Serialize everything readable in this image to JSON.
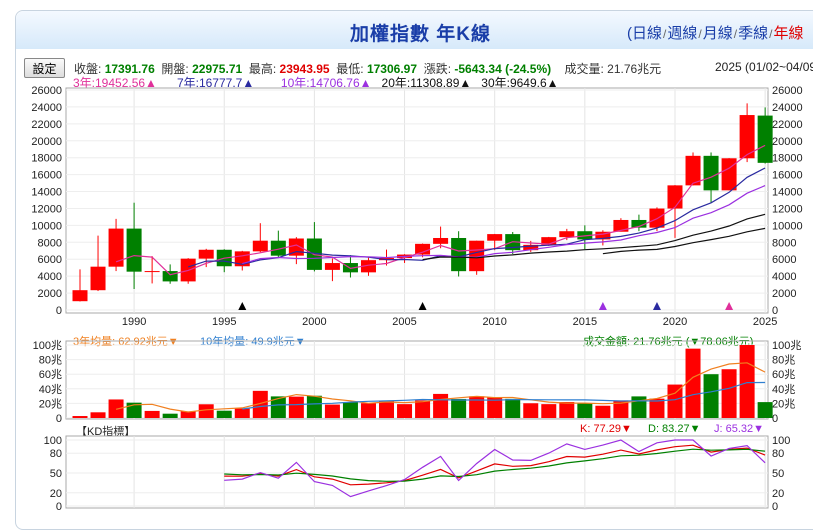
{
  "title": "加權指數 年K線",
  "periods": [
    {
      "label": "日線"
    },
    {
      "label": "週線"
    },
    {
      "label": "月線"
    },
    {
      "label": "季線"
    },
    {
      "label": "年線"
    }
  ],
  "settings_label": "設定",
  "quote": {
    "close_label": "收盤:",
    "close": "17391.76",
    "open_label": "開盤:",
    "open": "22975.71",
    "high_label": "最高:",
    "high": "23943.95",
    "low_label": "最低:",
    "low": "17306.97",
    "change_label": "漲跌:",
    "change": "-5643.34",
    "change_pct": "(-24.5%)",
    "volume_label": "成交量:",
    "volume": "21.76兆元",
    "date": "2025 (01/02~04/09"
  },
  "ma": [
    {
      "label": "3年:19452.56▲",
      "color": "#e0309a"
    },
    {
      "label": "7年:16777.7▲",
      "color": "#2a2aa0"
    },
    {
      "label": "10年:14706.76▲",
      "color": "#9b30e0"
    },
    {
      "label": "20年:11308.89▲",
      "color": "#111111"
    },
    {
      "label": "30年:9649.6▲",
      "color": "#111111"
    }
  ],
  "price_axis": [
    "26000",
    "24000",
    "22000",
    "20000",
    "18000",
    "16000",
    "14000",
    "12000",
    "10000",
    "8000",
    "6000",
    "4000",
    "2000",
    "0"
  ],
  "year_axis": [
    "1990",
    "1995",
    "2000",
    "2005",
    "2010",
    "2015",
    "2020",
    "2025"
  ],
  "volume_header": {
    "ma3": "3年均量: 62.92兆元▼",
    "ma10": "10年均量: 49.9兆元▼",
    "amount": "成交金額: 21.76兆元 (▼78.06兆元)"
  },
  "volume_axis": [
    "100兆",
    "80兆",
    "60兆",
    "40兆",
    "20兆",
    "0"
  ],
  "kd_header": {
    "title": "【KD指標】",
    "k": "K: 77.29▼",
    "d": "D: 83.27▼",
    "j": "J: 65.32▼"
  },
  "kd_axis": [
    "100",
    "80",
    "50",
    "20",
    "0"
  ],
  "colors": {
    "up": "#ff0000",
    "down": "#008000"
  },
  "markers": [
    {
      "year": 1996,
      "color": "#000000"
    },
    {
      "year": 2006,
      "color": "#000000"
    },
    {
      "year": 2016,
      "color": "#9b30e0"
    },
    {
      "year": 2019,
      "color": "#2a2aa0"
    },
    {
      "year": 2023,
      "color": "#e0309a"
    }
  ],
  "chart_data": {
    "type": "candlestick",
    "start_year": 1987,
    "ohlc": [
      [
        1040,
        4796,
        1000,
        2340
      ],
      [
        2340,
        8790,
        2240,
        5120
      ],
      [
        5120,
        10770,
        4600,
        9620
      ],
      [
        9620,
        12680,
        2480,
        4530
      ],
      [
        4530,
        6370,
        3140,
        4600
      ],
      [
        4600,
        5390,
        3100,
        3380
      ],
      [
        3380,
        6130,
        3100,
        6070
      ],
      [
        6070,
        7230,
        5070,
        7120
      ],
      [
        7120,
        7180,
        4470,
        5170
      ],
      [
        5170,
        6990,
        4670,
        6930
      ],
      [
        6930,
        10260,
        6820,
        8190
      ],
      [
        8190,
        9380,
        6220,
        6420
      ],
      [
        6420,
        8610,
        5420,
        8450
      ],
      [
        8450,
        10390,
        4560,
        4740
      ],
      [
        4740,
        6100,
        3410,
        5550
      ],
      [
        5550,
        6480,
        3840,
        4450
      ],
      [
        4450,
        6180,
        4040,
        5890
      ],
      [
        5890,
        7140,
        5250,
        6140
      ],
      [
        6140,
        6600,
        5560,
        6550
      ],
      [
        6550,
        7860,
        6230,
        7820
      ],
      [
        7820,
        9860,
        7300,
        8510
      ],
      [
        8510,
        9310,
        3960,
        4590
      ],
      [
        4590,
        8190,
        4160,
        8190
      ],
      [
        8190,
        8990,
        7070,
        8970
      ],
      [
        8970,
        9220,
        6610,
        7070
      ],
      [
        7070,
        8170,
        6860,
        7700
      ],
      [
        7700,
        8640,
        7580,
        8610
      ],
      [
        8610,
        9590,
        8260,
        9310
      ],
      [
        9310,
        10010,
        7200,
        8340
      ],
      [
        8340,
        9430,
        7630,
        9250
      ],
      [
        9250,
        10850,
        9270,
        10640
      ],
      [
        10640,
        11270,
        9320,
        9730
      ],
      [
        9730,
        12130,
        9320,
        11990
      ],
      [
        11990,
        14760,
        8520,
        14730
      ],
      [
        14730,
        18620,
        14720,
        18220
      ],
      [
        18220,
        18620,
        12630,
        14140
      ],
      [
        14140,
        17950,
        14140,
        17930
      ],
      [
        17930,
        24420,
        17480,
        23040
      ],
      [
        22976,
        23944,
        17307,
        17392
      ]
    ],
    "volume": [
      2.7,
      7.8,
      25.4,
      21,
      9.7,
      5.9,
      9,
      18.8,
      10,
      12.9,
      37.2,
      29.6,
      29.3,
      30.5,
      18.4,
      21.9,
      20.3,
      23.9,
      19,
      24,
      33,
      26.1,
      29.7,
      28.2,
      26.2,
      20.2,
      19,
      21.9,
      20.2,
      16.8,
      24.1,
      29.6,
      26.5,
      45.8,
      95,
      60,
      66.8,
      100,
      21.76
    ],
    "price_range": [
      0,
      26000
    ],
    "volume_range": [
      0,
      100
    ],
    "kd_range": [
      0,
      100
    ]
  }
}
